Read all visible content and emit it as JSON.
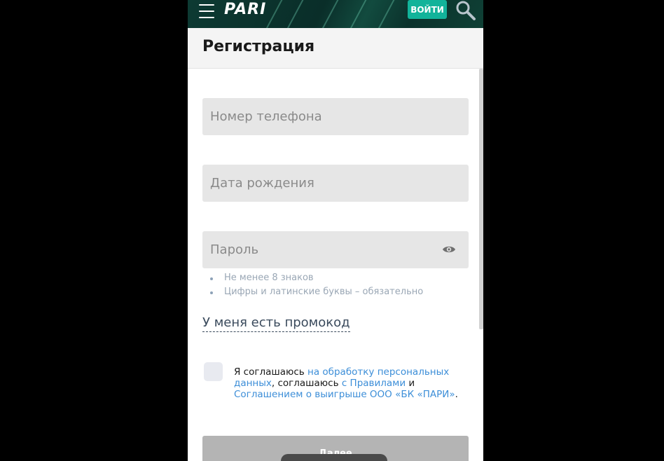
{
  "header": {
    "logo_text": "PARI",
    "login_label": "ВОЙТИ",
    "accent_color": "#12b39a"
  },
  "page": {
    "title": "Регистрация"
  },
  "form": {
    "phone_placeholder": "Номер телефона",
    "birthdate_placeholder": "Дата рождения",
    "password_placeholder": "Пароль",
    "password_hints": [
      "Не менее 8 знаков",
      "Цифры и латинские буквы – обязательно"
    ],
    "promo_link": "У меня есть промокод",
    "agreement": {
      "part1": "Я соглашаюсь ",
      "link1": "на обработку персональных данных",
      "part2": ", соглашаюсь ",
      "link2": "с Правилами",
      "part3": " и ",
      "link3": "Соглашением о выигрыше ООО «БК «ПАРИ»",
      "part4": "."
    },
    "submit_label": "Далее"
  },
  "icons": {
    "menu": "hamburger-icon",
    "search": "search-icon",
    "eye": "eye-icon"
  }
}
